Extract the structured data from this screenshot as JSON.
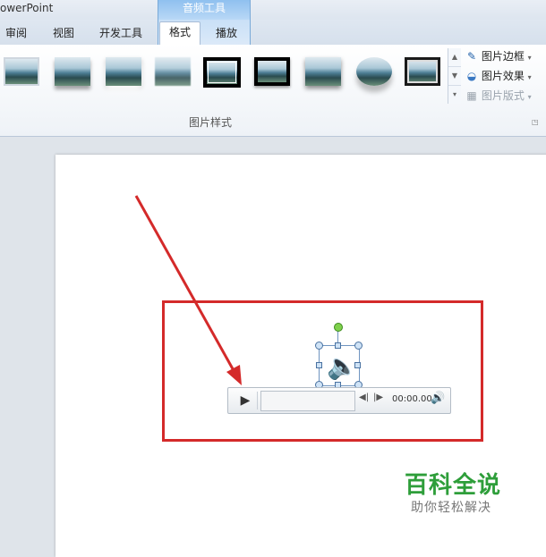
{
  "window": {
    "title": "owerPoint"
  },
  "ribbon": {
    "context_group": "音频工具",
    "tabs": [
      {
        "label": "审阅"
      },
      {
        "label": "视图"
      },
      {
        "label": "开发工具"
      },
      {
        "label": "格式"
      },
      {
        "label": "播放"
      }
    ],
    "active_tab": "格式",
    "gallery_group_label": "图片样式",
    "side_commands": [
      {
        "label": "图片边框",
        "icon": "pen-icon"
      },
      {
        "label": "图片效果",
        "icon": "effects-icon"
      },
      {
        "label": "图片版式",
        "icon": "layout-icon",
        "enabled": false
      }
    ],
    "picture_styles": [
      "simple-frame",
      "soft-shadow",
      "reflected",
      "soft-edge",
      "double-frame-black",
      "thick-matte-black",
      "drop-shadow",
      "oval",
      "metal-frame"
    ]
  },
  "player": {
    "time": "00:00.00"
  },
  "watermark": {
    "main": "百科全说",
    "sub": "助你轻松解决"
  },
  "colors": {
    "accent_red": "#d42a2a",
    "watermark_green": "#2e9e3a",
    "context_tab": "#8fc0ef"
  }
}
